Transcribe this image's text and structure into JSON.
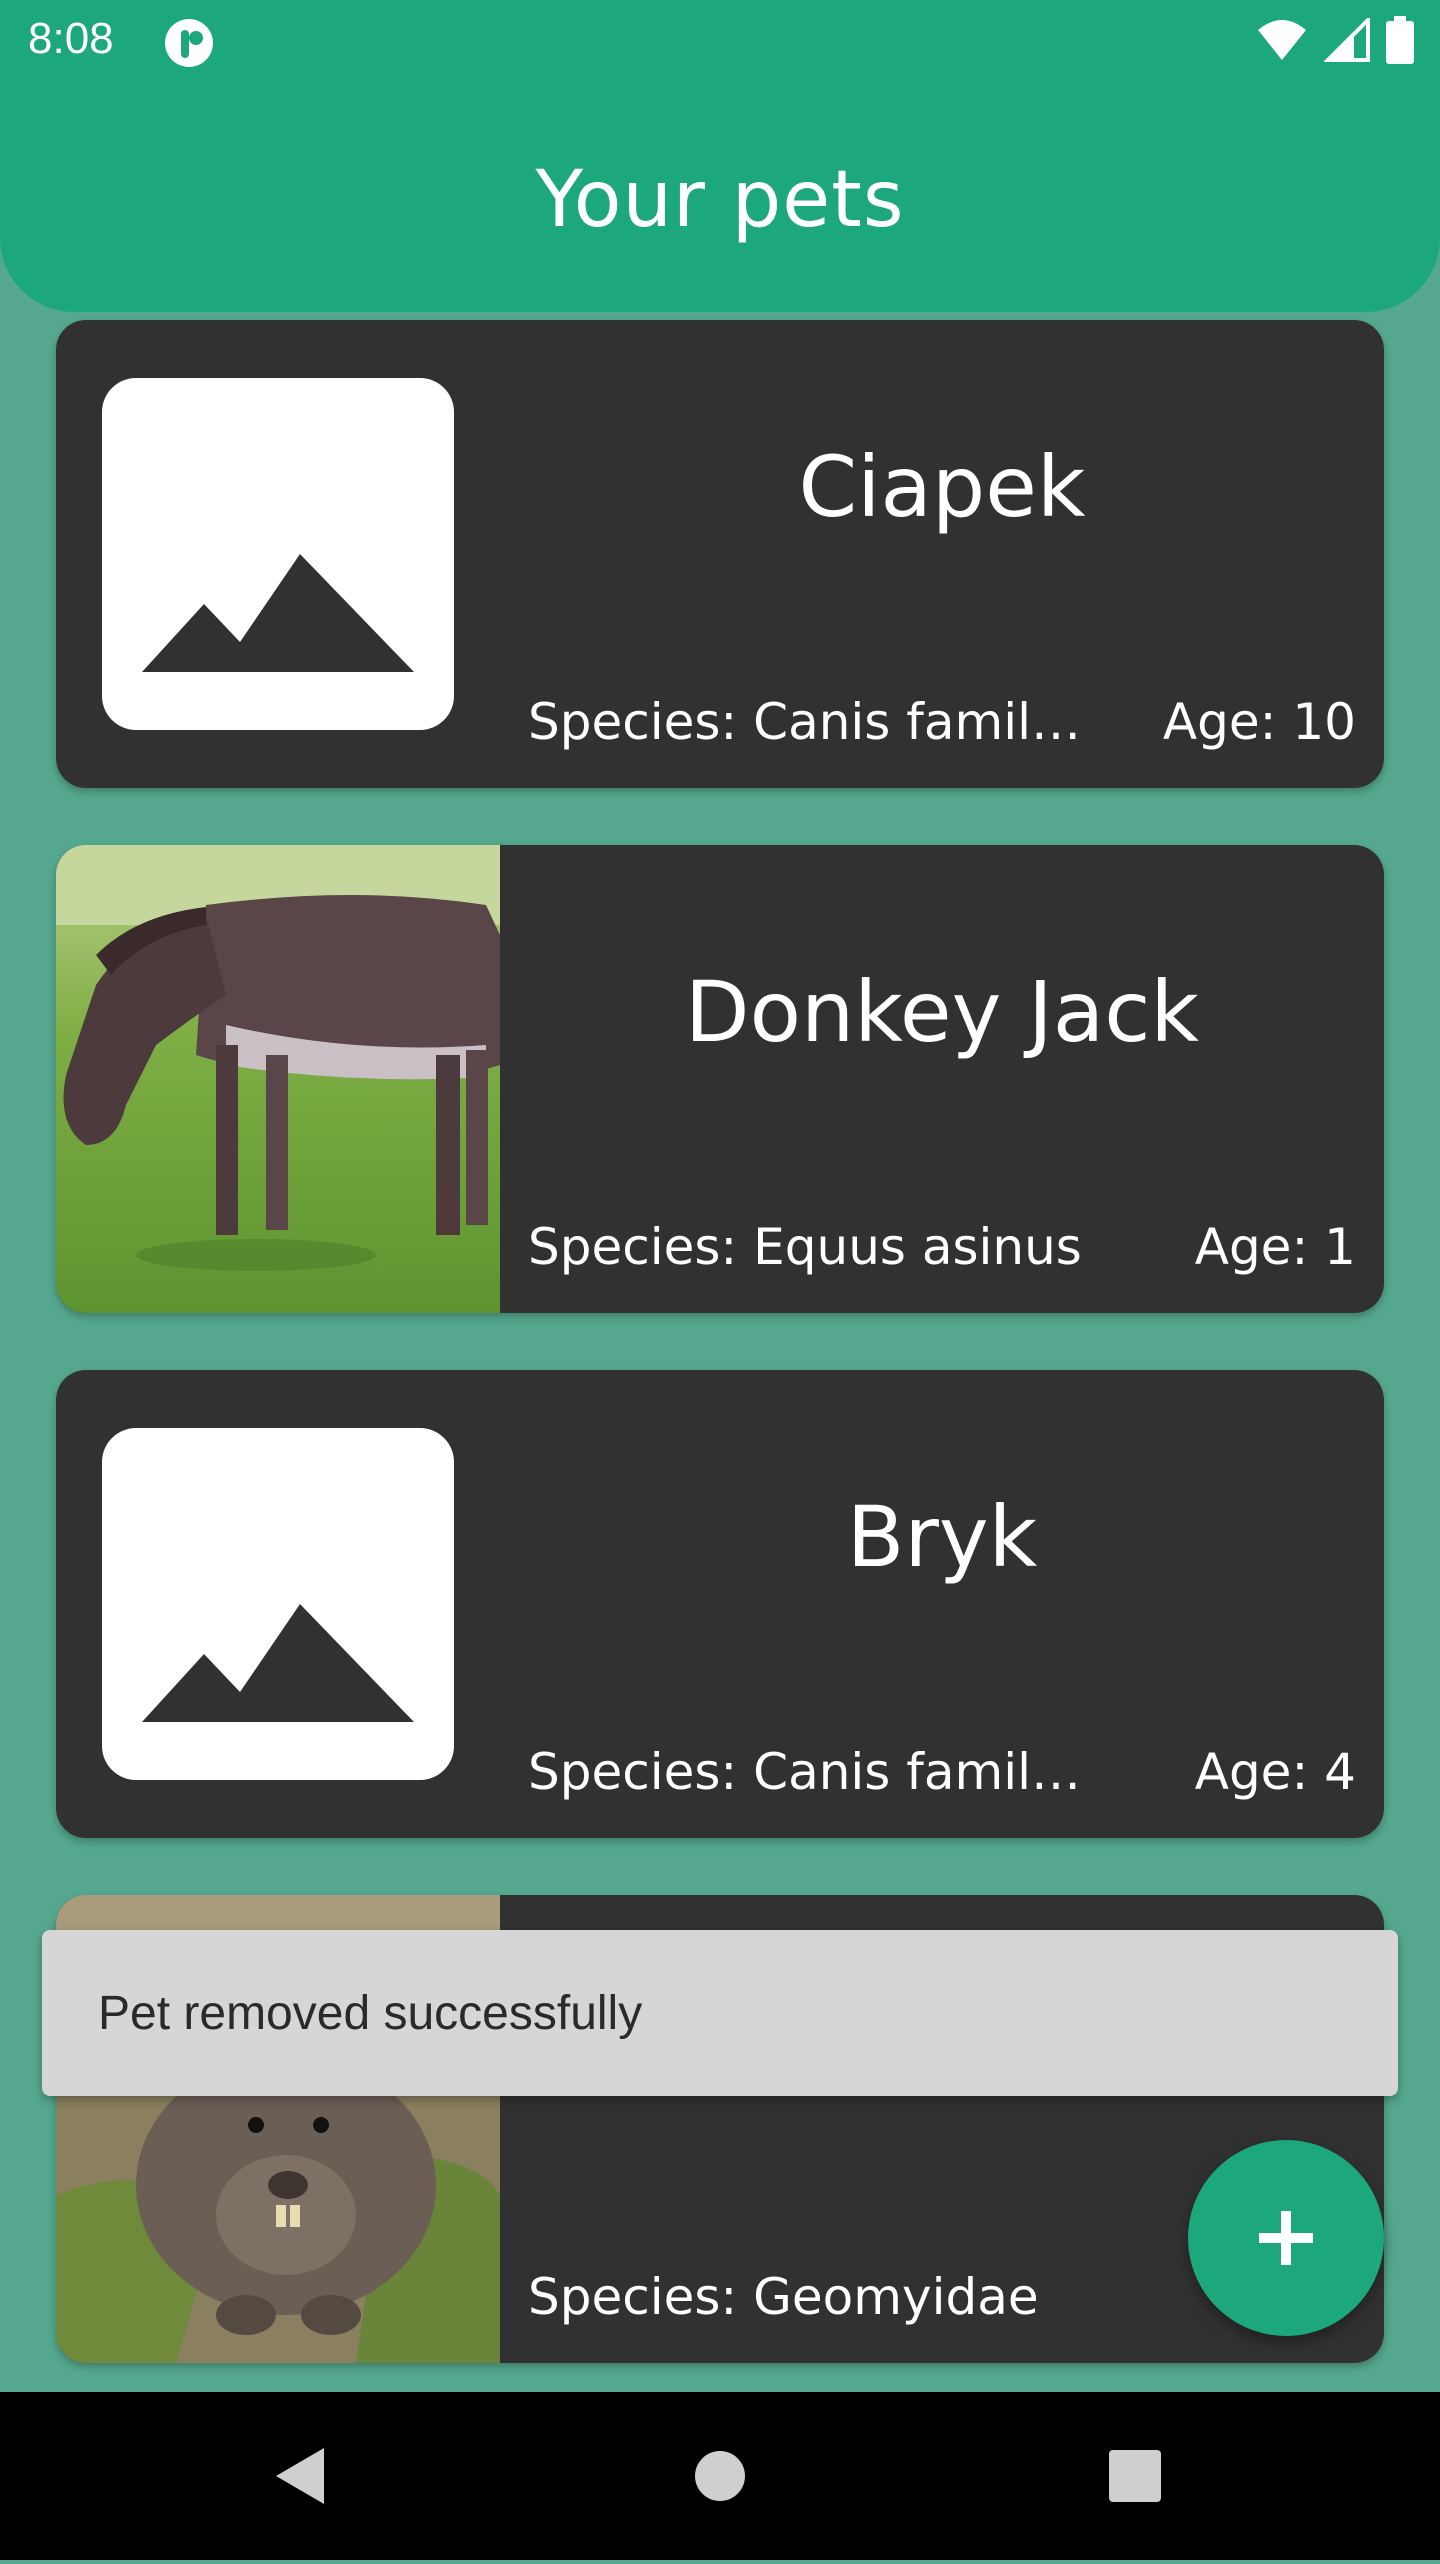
{
  "status_bar": {
    "time": "8:08",
    "icons": [
      "app-notification-icon",
      "wifi-icon",
      "cell-signal-icon",
      "battery-icon"
    ]
  },
  "header": {
    "title": "Your pets"
  },
  "pets": [
    {
      "name": "Ciapek",
      "species": "Species: Canis famili...",
      "age": "Age: 10",
      "image": "placeholder-image-icon"
    },
    {
      "name": "Donkey Jack",
      "species": "Species: Equus asinus",
      "age": "Age: 1",
      "image": "donkey-photo"
    },
    {
      "name": "Bryk",
      "species": "Species: Canis famili...",
      "age": "Age: 4",
      "image": "placeholder-image-icon"
    },
    {
      "name": "",
      "species": "Species: Geomyidae",
      "age": "",
      "image": "gopher-photo"
    }
  ],
  "snackbar": {
    "message": "Pet removed successfully"
  },
  "fab": {
    "icon": "plus-icon"
  },
  "nav": {
    "buttons": [
      "back-icon",
      "home-icon",
      "recents-icon"
    ]
  },
  "colors": {
    "primary": "#1ca77c",
    "background": "#55a88f",
    "card": "#313131",
    "snackbar": "#d6d6d6"
  }
}
